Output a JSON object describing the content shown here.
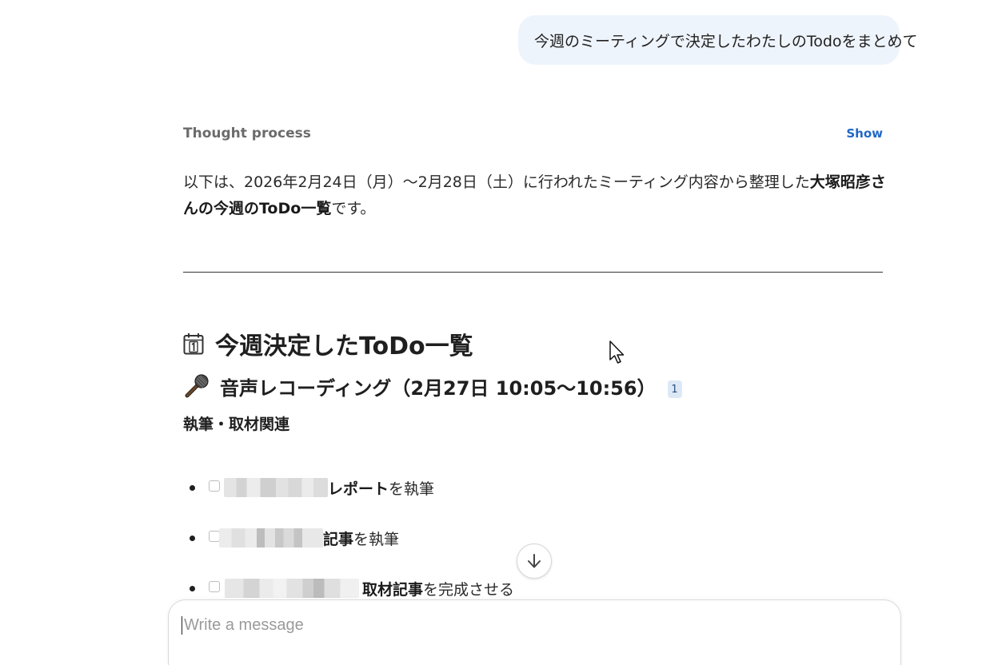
{
  "user_message": {
    "text": "今週のミーティングで決定したわたしのTodoをまとめて"
  },
  "thought": {
    "label": "Thought process",
    "toggle_label": "Show"
  },
  "intro": {
    "part1": "以下は、2026年2月24日（月）～2月28日（土）に行われたミーティング内容から整理した",
    "bold": "大塚昭彦さんの今週のToDo一覧",
    "part2": "です。"
  },
  "heading_main": {
    "icon": "calendar-icon",
    "text": "今週決定したToDo一覧"
  },
  "heading_recording": {
    "icon": "microphone-icon",
    "text": "音声レコーディング（2月27日 10:05～10:56）",
    "citation": "1"
  },
  "section_label": "執筆・取材関連",
  "todos": [
    {
      "checked": false,
      "strong": "レポート",
      "rest": "を執筆"
    },
    {
      "checked": false,
      "strong": "記事",
      "rest": "を執筆"
    },
    {
      "checked": false,
      "strong": "取材記事",
      "rest": "を完成させる"
    }
  ],
  "scroll_button": {
    "icon": "arrow-down-icon"
  },
  "composer": {
    "placeholder": "Write a message",
    "value": ""
  },
  "colors": {
    "bubble_bg": "#eef4fb",
    "link": "#2168c5",
    "citation_bg": "#dde8f6"
  }
}
